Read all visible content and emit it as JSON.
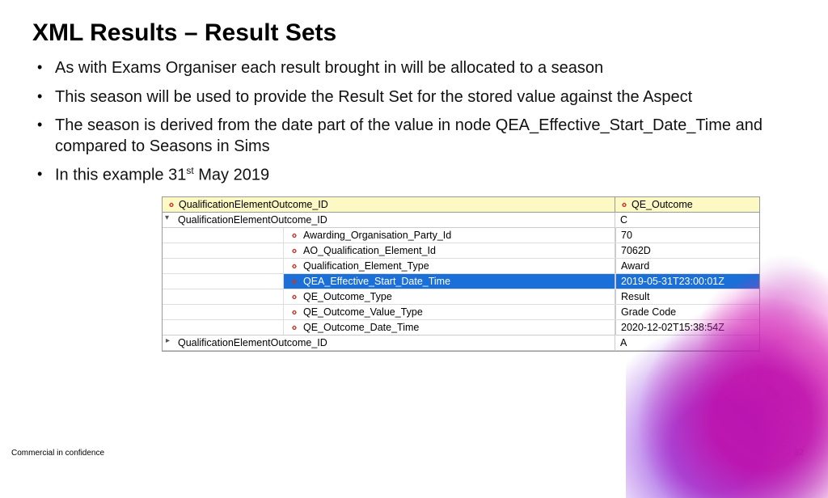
{
  "title": "XML Results – Result Sets",
  "bullets": [
    "As with Exams Organiser each result brought in will be allocated to a season",
    "This season will be used to provide the Result Set for the stored value against the Aspect",
    "The season is derived from the date part of the value in node QEA_Effective_Start_Date_Time and compared to Seasons in Sims",
    "In this example 31st May 2019"
  ],
  "grid": {
    "headers": {
      "col1": "QualificationElementOutcome_ID",
      "col2": "QE_Outcome"
    },
    "parentOpen": {
      "label": "QualificationElementOutcome_ID",
      "value": "C"
    },
    "rows": [
      {
        "name": "Awarding_Organisation_Party_Id",
        "value": "70",
        "selected": false
      },
      {
        "name": "AO_Qualification_Element_Id",
        "value": "7062D",
        "selected": false
      },
      {
        "name": "Qualification_Element_Type",
        "value": "Award",
        "selected": false
      },
      {
        "name": "QEA_Effective_Start_Date_Time",
        "value": "2019-05-31T23:00:01Z",
        "selected": true
      },
      {
        "name": "QE_Outcome_Type",
        "value": "Result",
        "selected": false
      },
      {
        "name": "QE_Outcome_Value_Type",
        "value": "Grade Code",
        "selected": false
      },
      {
        "name": "QE_Outcome_Date_Time",
        "value": "2020-12-02T15:38:54Z",
        "selected": false
      }
    ],
    "parentClosed": {
      "label": "QualificationElementOutcome_ID",
      "value": "A"
    }
  },
  "footer": "Commercial in confidence",
  "pageNumber": "32"
}
